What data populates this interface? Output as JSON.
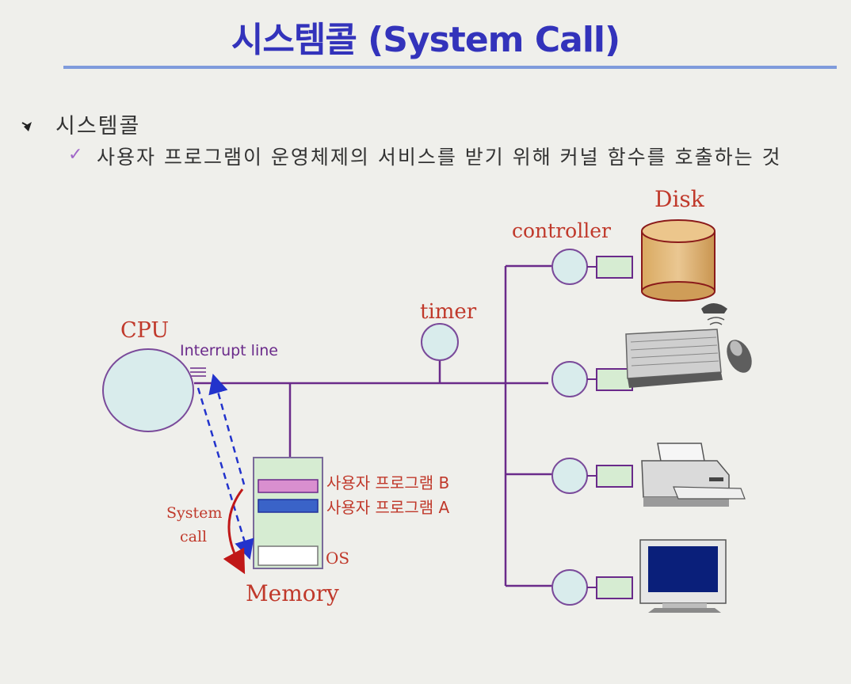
{
  "title": "시스템콜 (System Call)",
  "bullet": "시스템콜",
  "sub_bullet": "사용자 프로그램이 운영체제의 서비스를 받기 위해 커널 함수를 호출하는 것",
  "labels": {
    "cpu": "CPU",
    "interrupt_line": "Interrupt line",
    "timer": "timer",
    "controller": "controller",
    "disk": "Disk",
    "memory": "Memory",
    "program_b": "사용자 프로그램 B",
    "program_a": "사용자 프로그램 A",
    "os": "OS",
    "system_call_1": "System",
    "system_call_2": "call"
  },
  "colors": {
    "title": "#3333bb",
    "rule": "#7f9bdc",
    "bus": "#6a2a8a",
    "label_red": "#c0392b",
    "circle_fill": "#d9ecec",
    "memory_fill": "#d6ecd2",
    "program_b": "#d98fcf",
    "program_a": "#3a63c8",
    "disk_fill": "#e2b876",
    "call_arrow": "#c01818",
    "dashed_arrow": "#2233cc"
  },
  "icons": [
    "bullet-arrow-icon",
    "checkmark-icon",
    "disk-icon",
    "keyboard-mouse-icon",
    "printer-icon",
    "monitor-icon"
  ]
}
